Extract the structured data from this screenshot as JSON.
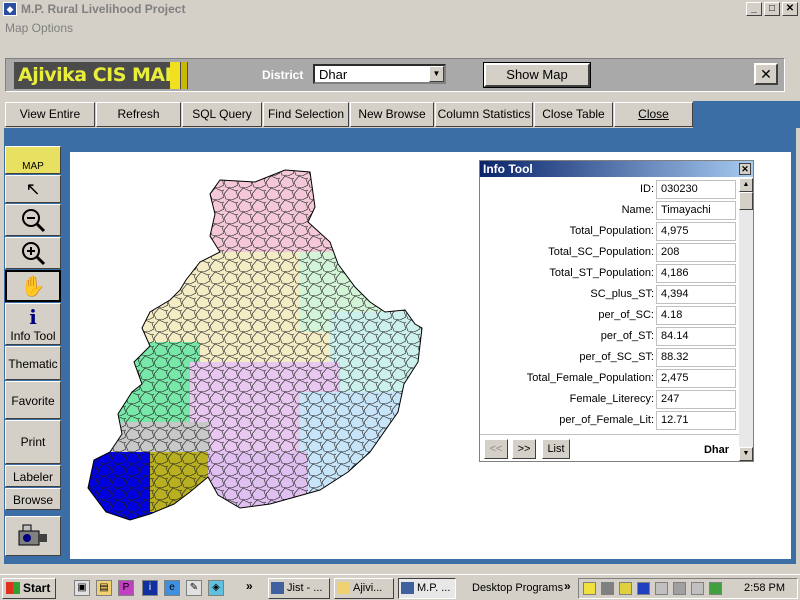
{
  "window": {
    "title": "M.P. Rural Livelihood Project",
    "min": "_",
    "max": "□",
    "close": "✕"
  },
  "menu": {
    "map_options": "Map Options"
  },
  "header": {
    "logo": "Ajivika CIS MAP",
    "district_label": "District",
    "district_value": "Dhar",
    "show_map": "Show Map",
    "close": "✕"
  },
  "toolbar": {
    "view_entire": "View Entire",
    "refresh": "Refresh",
    "sql_query": "SQL Query",
    "find_selection": "Find Selection",
    "new_browse": "New Browse",
    "column_statistics": "Column Statistics",
    "close_table": "Close Table",
    "close": "Close"
  },
  "side_tools": {
    "map": "MAP",
    "info_tool": "Info Tool",
    "thematic": "Thematic",
    "favorite": "Favorite",
    "print": "Print",
    "labeler": "Labeler",
    "browse": "Browse"
  },
  "info_tool": {
    "title": "Info Tool",
    "rows": [
      {
        "key": "ID:",
        "value": "030230"
      },
      {
        "key": "Name:",
        "value": "Timayachi"
      },
      {
        "key": "Total_Population:",
        "value": "4,975"
      },
      {
        "key": "Total_SC_Population:",
        "value": "208"
      },
      {
        "key": "Total_ST_Population:",
        "value": "4,186"
      },
      {
        "key": "SC_plus_ST:",
        "value": "4,394"
      },
      {
        "key": "per_of_SC:",
        "value": "4.18"
      },
      {
        "key": "per_of_ST:",
        "value": "84.14"
      },
      {
        "key": "per_of_SC_ST:",
        "value": "88.32"
      },
      {
        "key": "Total_Female_Population:",
        "value": "2,475"
      },
      {
        "key": "Female_Literecy:",
        "value": "247"
      },
      {
        "key": "per_of_Female_Lit:",
        "value": "12.71"
      }
    ],
    "prev": "<<",
    "next": ">>",
    "list": "List",
    "district": "Dhar"
  },
  "map_colors": {
    "pink": "#f4c8d8",
    "cream": "#f4ecc4",
    "mint": "#d4f4d8",
    "green": "#78e8a8",
    "lavender": "#e8c8f0",
    "lightblue": "#c8e4f8",
    "cyan": "#ccf0ec",
    "gray": "#c8c8c8",
    "blue": "#0000e0",
    "olive": "#b8b020",
    "lilac": "#e0c0f0"
  },
  "taskbar": {
    "start": "Start",
    "tasks": [
      "Jist - ...",
      "Ajivi...",
      "M.P. ..."
    ],
    "overflow": "»",
    "desktop_programs": "Desktop Programs",
    "clock": "2:58 PM"
  }
}
